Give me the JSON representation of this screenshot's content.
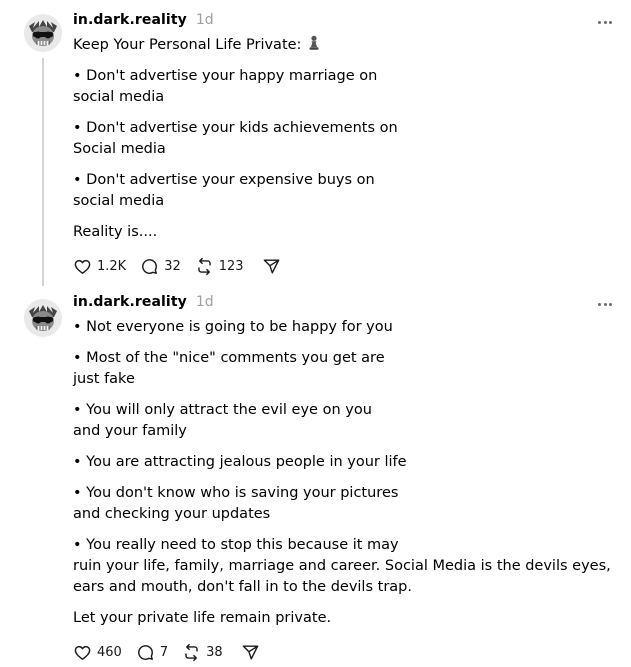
{
  "posts": [
    {
      "username": "in.dark.reality",
      "time": "1d",
      "title": "Keep Your Personal Life Private:",
      "title_emoji": "chess-pawn-emoji",
      "lines": [
        "• Don't advertise your happy marriage on\nsocial media",
        "• Don't advertise your kids achievements on\nSocial media",
        "• Don't advertise your expensive buys on\nsocial media",
        "Reality is...."
      ],
      "likes": "1.2K",
      "replies": "32",
      "reposts": "123"
    },
    {
      "username": "in.dark.reality",
      "time": "1d",
      "lines": [
        "• Not everyone is going to be happy for you",
        "• Most of the \"nice\" comments you get are\njust fake",
        "• You will only attract the evil eye on you\nand your family",
        "• You are attracting jealous people in your life",
        "• You don't know who is saving your pictures\nand checking your updates",
        "• You really need to stop this because it may\nruin your life, family, marriage and career. Social Media is the devils eyes,\nears and mouth, don't fall in to the devils trap.",
        "Let your private life remain private."
      ],
      "likes": "460",
      "replies": "7",
      "reposts": "38"
    }
  ],
  "icons": {
    "avatar": "skull-with-sunglasses-avatar",
    "more": "more-dots-icon",
    "like": "heart-icon",
    "reply": "comment-icon",
    "repost": "repost-icon",
    "share": "send-icon"
  }
}
